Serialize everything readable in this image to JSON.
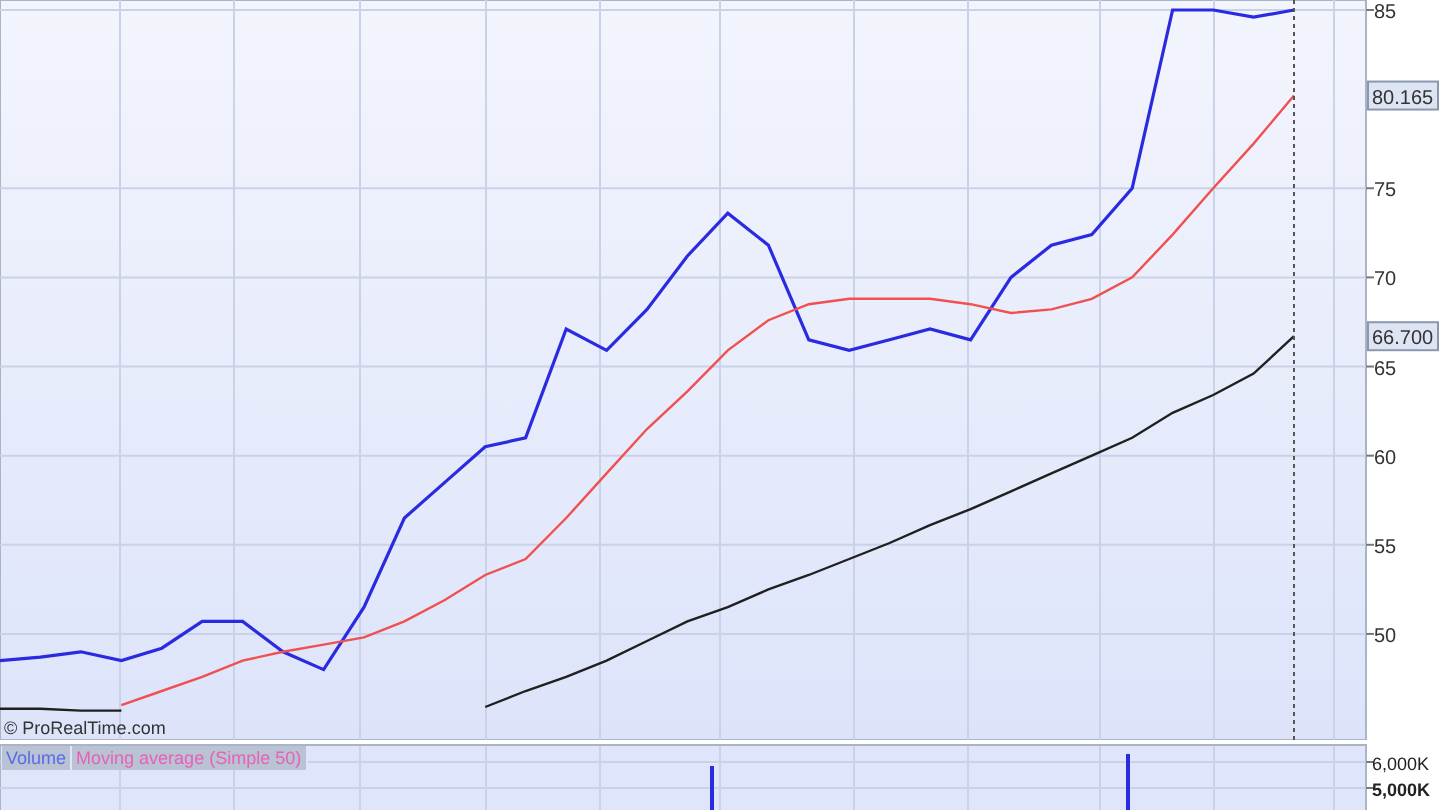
{
  "price_panel": {
    "copyright_notice": "© ProRealTime.com",
    "chart_data": {
      "type": "line",
      "grid": true,
      "series": [
        {
          "color": "#2a2ae0",
          "values": [
            48.5,
            48.7,
            49.0,
            48.5,
            49.2,
            50.7,
            50.7,
            49.0,
            48.0,
            51.5,
            56.5,
            58.5,
            60.5,
            61.0,
            67.1,
            65.9,
            68.2,
            71.2,
            73.6,
            71.8,
            66.5,
            65.9,
            66.5,
            67.1,
            66.5,
            70.0,
            71.8,
            72.4,
            75.0,
            85.0,
            85.0,
            84.6,
            85.0
          ]
        },
        {
          "color": "#f05050",
          "values": [
            null,
            null,
            null,
            46.0,
            46.8,
            47.6,
            48.5,
            49.0,
            49.4,
            49.8,
            50.7,
            51.9,
            53.3,
            54.2,
            56.5,
            59.0,
            61.5,
            63.6,
            65.9,
            67.6,
            68.5,
            68.8,
            68.8,
            68.8,
            68.5,
            68.0,
            68.2,
            68.8,
            70.0,
            72.4,
            75.0,
            77.5,
            80.2
          ]
        },
        {
          "color": "#202020",
          "values": [
            45.8,
            45.8,
            45.7,
            45.7,
            null,
            null,
            null,
            null,
            null,
            null,
            null,
            null,
            45.9,
            46.8,
            47.6,
            48.5,
            49.6,
            50.7,
            51.5,
            52.5,
            53.3,
            54.2,
            55.1,
            56.1,
            57.0,
            58.0,
            59.0,
            60.0,
            61.0,
            62.4,
            63.4,
            64.6,
            66.7
          ]
        }
      ],
      "ylim": [
        44.05,
        85.56
      ],
      "yticks": [
        50,
        55,
        60,
        65,
        70,
        75,
        85
      ]
    },
    "value_labels": [
      {
        "text": "80.165",
        "kind": "moving-average"
      },
      {
        "text": "66.700",
        "kind": "long-average"
      }
    ]
  },
  "volume_panel": {
    "legend": [
      {
        "text": "Volume",
        "color": "#5a6ae8"
      },
      {
        "text": "Moving average (Simple 50)",
        "color": "#e860b8"
      }
    ],
    "axis_labels": [
      {
        "text": "6,000K",
        "emphasized": false
      },
      {
        "text": "5,000K",
        "emphasized": true
      }
    ]
  }
}
